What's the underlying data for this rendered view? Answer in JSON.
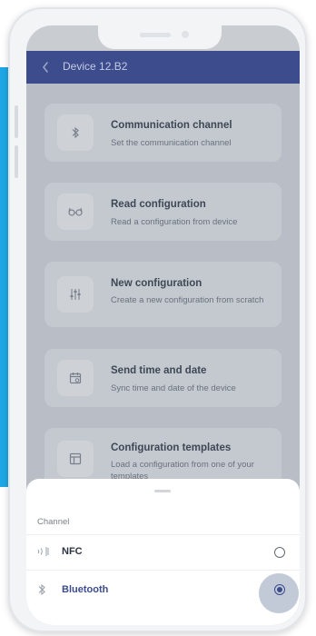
{
  "colors": {
    "accent": "#1ea7e6",
    "appbar": "#3c4c8c",
    "selected": "#3c4c8c"
  },
  "appbar": {
    "back_icon": "chevron-left-icon",
    "title": "Device 12.B2"
  },
  "menu": [
    {
      "icon": "bluetooth-icon",
      "title": "Communication channel",
      "subtitle": "Set the communication channel"
    },
    {
      "icon": "glasses-icon",
      "title": "Read configuration",
      "subtitle": "Read a configuration from device"
    },
    {
      "icon": "settings-sliders-icon",
      "title": "New configuration",
      "subtitle": "Create a new configuration from scratch"
    },
    {
      "icon": "calendar-icon",
      "title": "Send time and date",
      "subtitle": "Sync time and date of the device"
    },
    {
      "icon": "template-icon",
      "title": "Configuration templates",
      "subtitle": "Load a configuration from one of your templates"
    }
  ],
  "sheet": {
    "label": "Channel",
    "options": [
      {
        "icon": "nfc-icon",
        "label": "NFC",
        "selected": false
      },
      {
        "icon": "bluetooth-icon",
        "label": "Bluetooth",
        "selected": true
      }
    ]
  }
}
